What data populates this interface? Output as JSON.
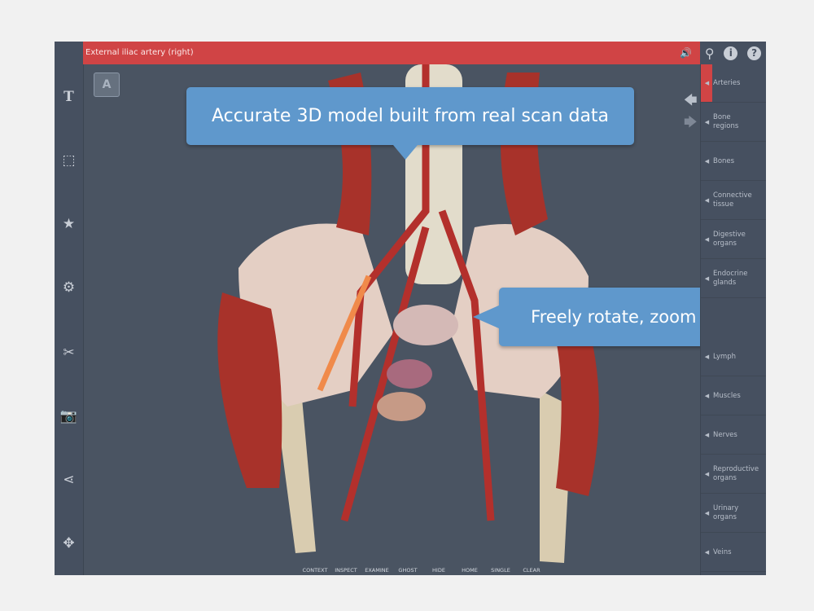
{
  "header": {
    "title": "External iliac artery (right)",
    "sound_icon": "speaker-icon"
  },
  "tools": [
    "search-icon",
    "info-icon",
    "help-icon"
  ],
  "left_sidebar": [
    {
      "icon": "text-icon",
      "glyph": "T"
    },
    {
      "icon": "crop-frame-icon",
      "glyph": "⬚"
    },
    {
      "icon": "star-icon",
      "glyph": "★"
    },
    {
      "icon": "gear-icon",
      "glyph": "⚙"
    },
    {
      "icon": "tools-icon",
      "glyph": "✂"
    },
    {
      "icon": "camera-icon",
      "glyph": "📷"
    },
    {
      "icon": "share-icon",
      "glyph": "⋖"
    },
    {
      "icon": "move-icon",
      "glyph": "✥"
    }
  ],
  "categories": [
    {
      "label": "Arteries",
      "active": true
    },
    {
      "label": "Bone regions"
    },
    {
      "label": "Bones"
    },
    {
      "label": "Connective tissue"
    },
    {
      "label": "Digestive organs"
    },
    {
      "label": "Endocrine glands"
    },
    {
      "label": "Lymph"
    },
    {
      "label": "Muscles"
    },
    {
      "label": "Nerves"
    },
    {
      "label": "Reproductive organs"
    },
    {
      "label": "Urinary organs"
    },
    {
      "label": "Veins"
    }
  ],
  "callouts": {
    "top": "Accurate 3D model built from real scan data",
    "right": "Freely rotate, zoom and pan"
  },
  "cube_label": "A",
  "toolbar": [
    {
      "label": "CONTEXT",
      "icon": "context-icon",
      "glyph": "▦"
    },
    {
      "label": "INSPECT",
      "icon": "inspect-icon",
      "glyph": "⤧"
    },
    {
      "label": "EXAMINE",
      "icon": "examine-icon",
      "glyph": "⁘"
    },
    {
      "label": "GHOST",
      "icon": "ghost-icon",
      "glyph": "○"
    },
    {
      "label": "HIDE",
      "icon": "hide-icon",
      "glyph": "⊖"
    },
    {
      "label": "HOME",
      "icon": "home-icon",
      "glyph": "■"
    },
    {
      "label": "SINGLE",
      "icon": "single-icon",
      "glyph": "↖"
    },
    {
      "label": "CLEAR",
      "icon": "clear-icon",
      "glyph": "✕"
    }
  ],
  "colors": {
    "accent": "#d04445",
    "background": "#4a5462",
    "callout": "#5f98cc",
    "home_active": "#f08a1e"
  }
}
